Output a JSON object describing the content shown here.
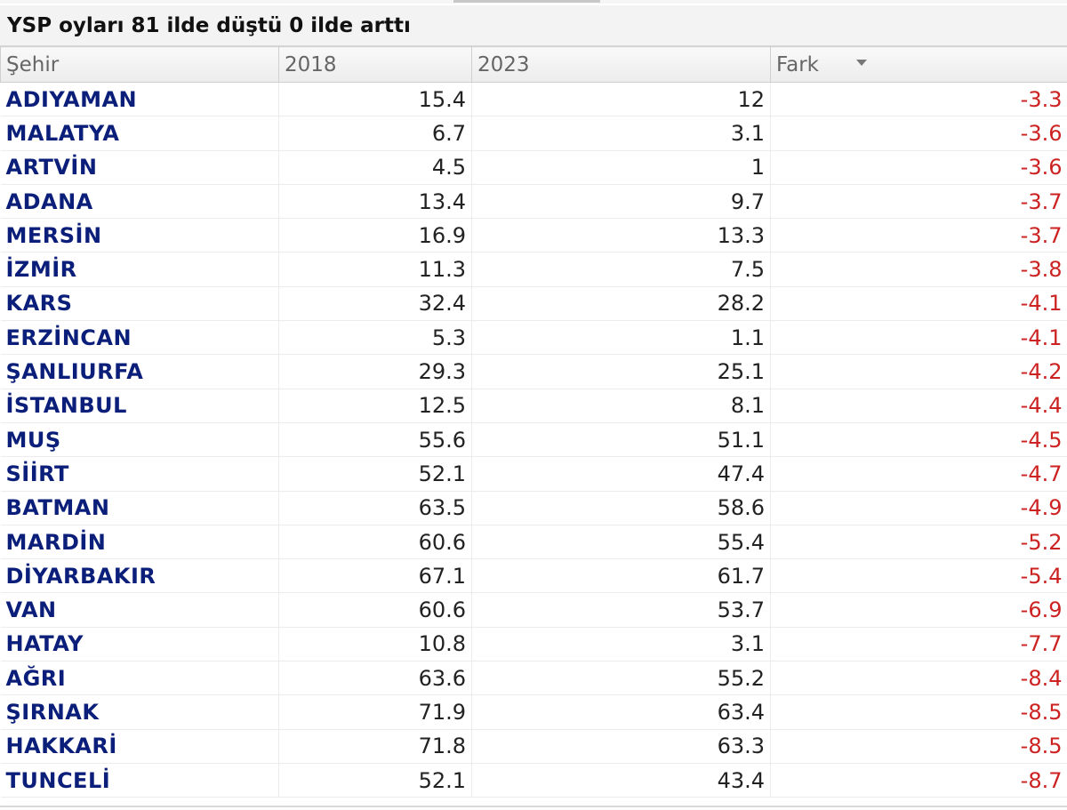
{
  "title": "YSP oyları 81 ilde düştü 0 ilde arttı",
  "columns": {
    "city": "Şehir",
    "y2018": "2018",
    "y2023": "2023",
    "diff": "Fark"
  },
  "sort": {
    "column": "Fark",
    "icon": "sort-desc-icon"
  },
  "colors": {
    "city_text": "#0b1f7a",
    "diff_text": "#cc2222",
    "header_bg": "#efefef"
  },
  "rows": [
    {
      "city": "ADIYAMAN",
      "y2018": "15.4",
      "y2023": "12",
      "diff": "-3.3"
    },
    {
      "city": "MALATYA",
      "y2018": "6.7",
      "y2023": "3.1",
      "diff": "-3.6"
    },
    {
      "city": "ARTVİN",
      "y2018": "4.5",
      "y2023": "1",
      "diff": "-3.6"
    },
    {
      "city": "ADANA",
      "y2018": "13.4",
      "y2023": "9.7",
      "diff": "-3.7"
    },
    {
      "city": "MERSİN",
      "y2018": "16.9",
      "y2023": "13.3",
      "diff": "-3.7"
    },
    {
      "city": "İZMİR",
      "y2018": "11.3",
      "y2023": "7.5",
      "diff": "-3.8"
    },
    {
      "city": "KARS",
      "y2018": "32.4",
      "y2023": "28.2",
      "diff": "-4.1"
    },
    {
      "city": "ERZİNCAN",
      "y2018": "5.3",
      "y2023": "1.1",
      "diff": "-4.1"
    },
    {
      "city": "ŞANLIURFA",
      "y2018": "29.3",
      "y2023": "25.1",
      "diff": "-4.2"
    },
    {
      "city": "İSTANBUL",
      "y2018": "12.5",
      "y2023": "8.1",
      "diff": "-4.4"
    },
    {
      "city": "MUŞ",
      "y2018": "55.6",
      "y2023": "51.1",
      "diff": "-4.5"
    },
    {
      "city": "SİİRT",
      "y2018": "52.1",
      "y2023": "47.4",
      "diff": "-4.7"
    },
    {
      "city": "BATMAN",
      "y2018": "63.5",
      "y2023": "58.6",
      "diff": "-4.9"
    },
    {
      "city": "MARDİN",
      "y2018": "60.6",
      "y2023": "55.4",
      "diff": "-5.2"
    },
    {
      "city": "DİYARBAKIR",
      "y2018": "67.1",
      "y2023": "61.7",
      "diff": "-5.4"
    },
    {
      "city": "VAN",
      "y2018": "60.6",
      "y2023": "53.7",
      "diff": "-6.9"
    },
    {
      "city": "HATAY",
      "y2018": "10.8",
      "y2023": "3.1",
      "diff": "-7.7"
    },
    {
      "city": "AĞRI",
      "y2018": "63.6",
      "y2023": "55.2",
      "diff": "-8.4"
    },
    {
      "city": "ŞIRNAK",
      "y2018": "71.9",
      "y2023": "63.4",
      "diff": "-8.5"
    },
    {
      "city": "HAKKARİ",
      "y2018": "71.8",
      "y2023": "63.3",
      "diff": "-8.5"
    },
    {
      "city": "TUNCELİ",
      "y2018": "52.1",
      "y2023": "43.4",
      "diff": "-8.7"
    }
  ]
}
